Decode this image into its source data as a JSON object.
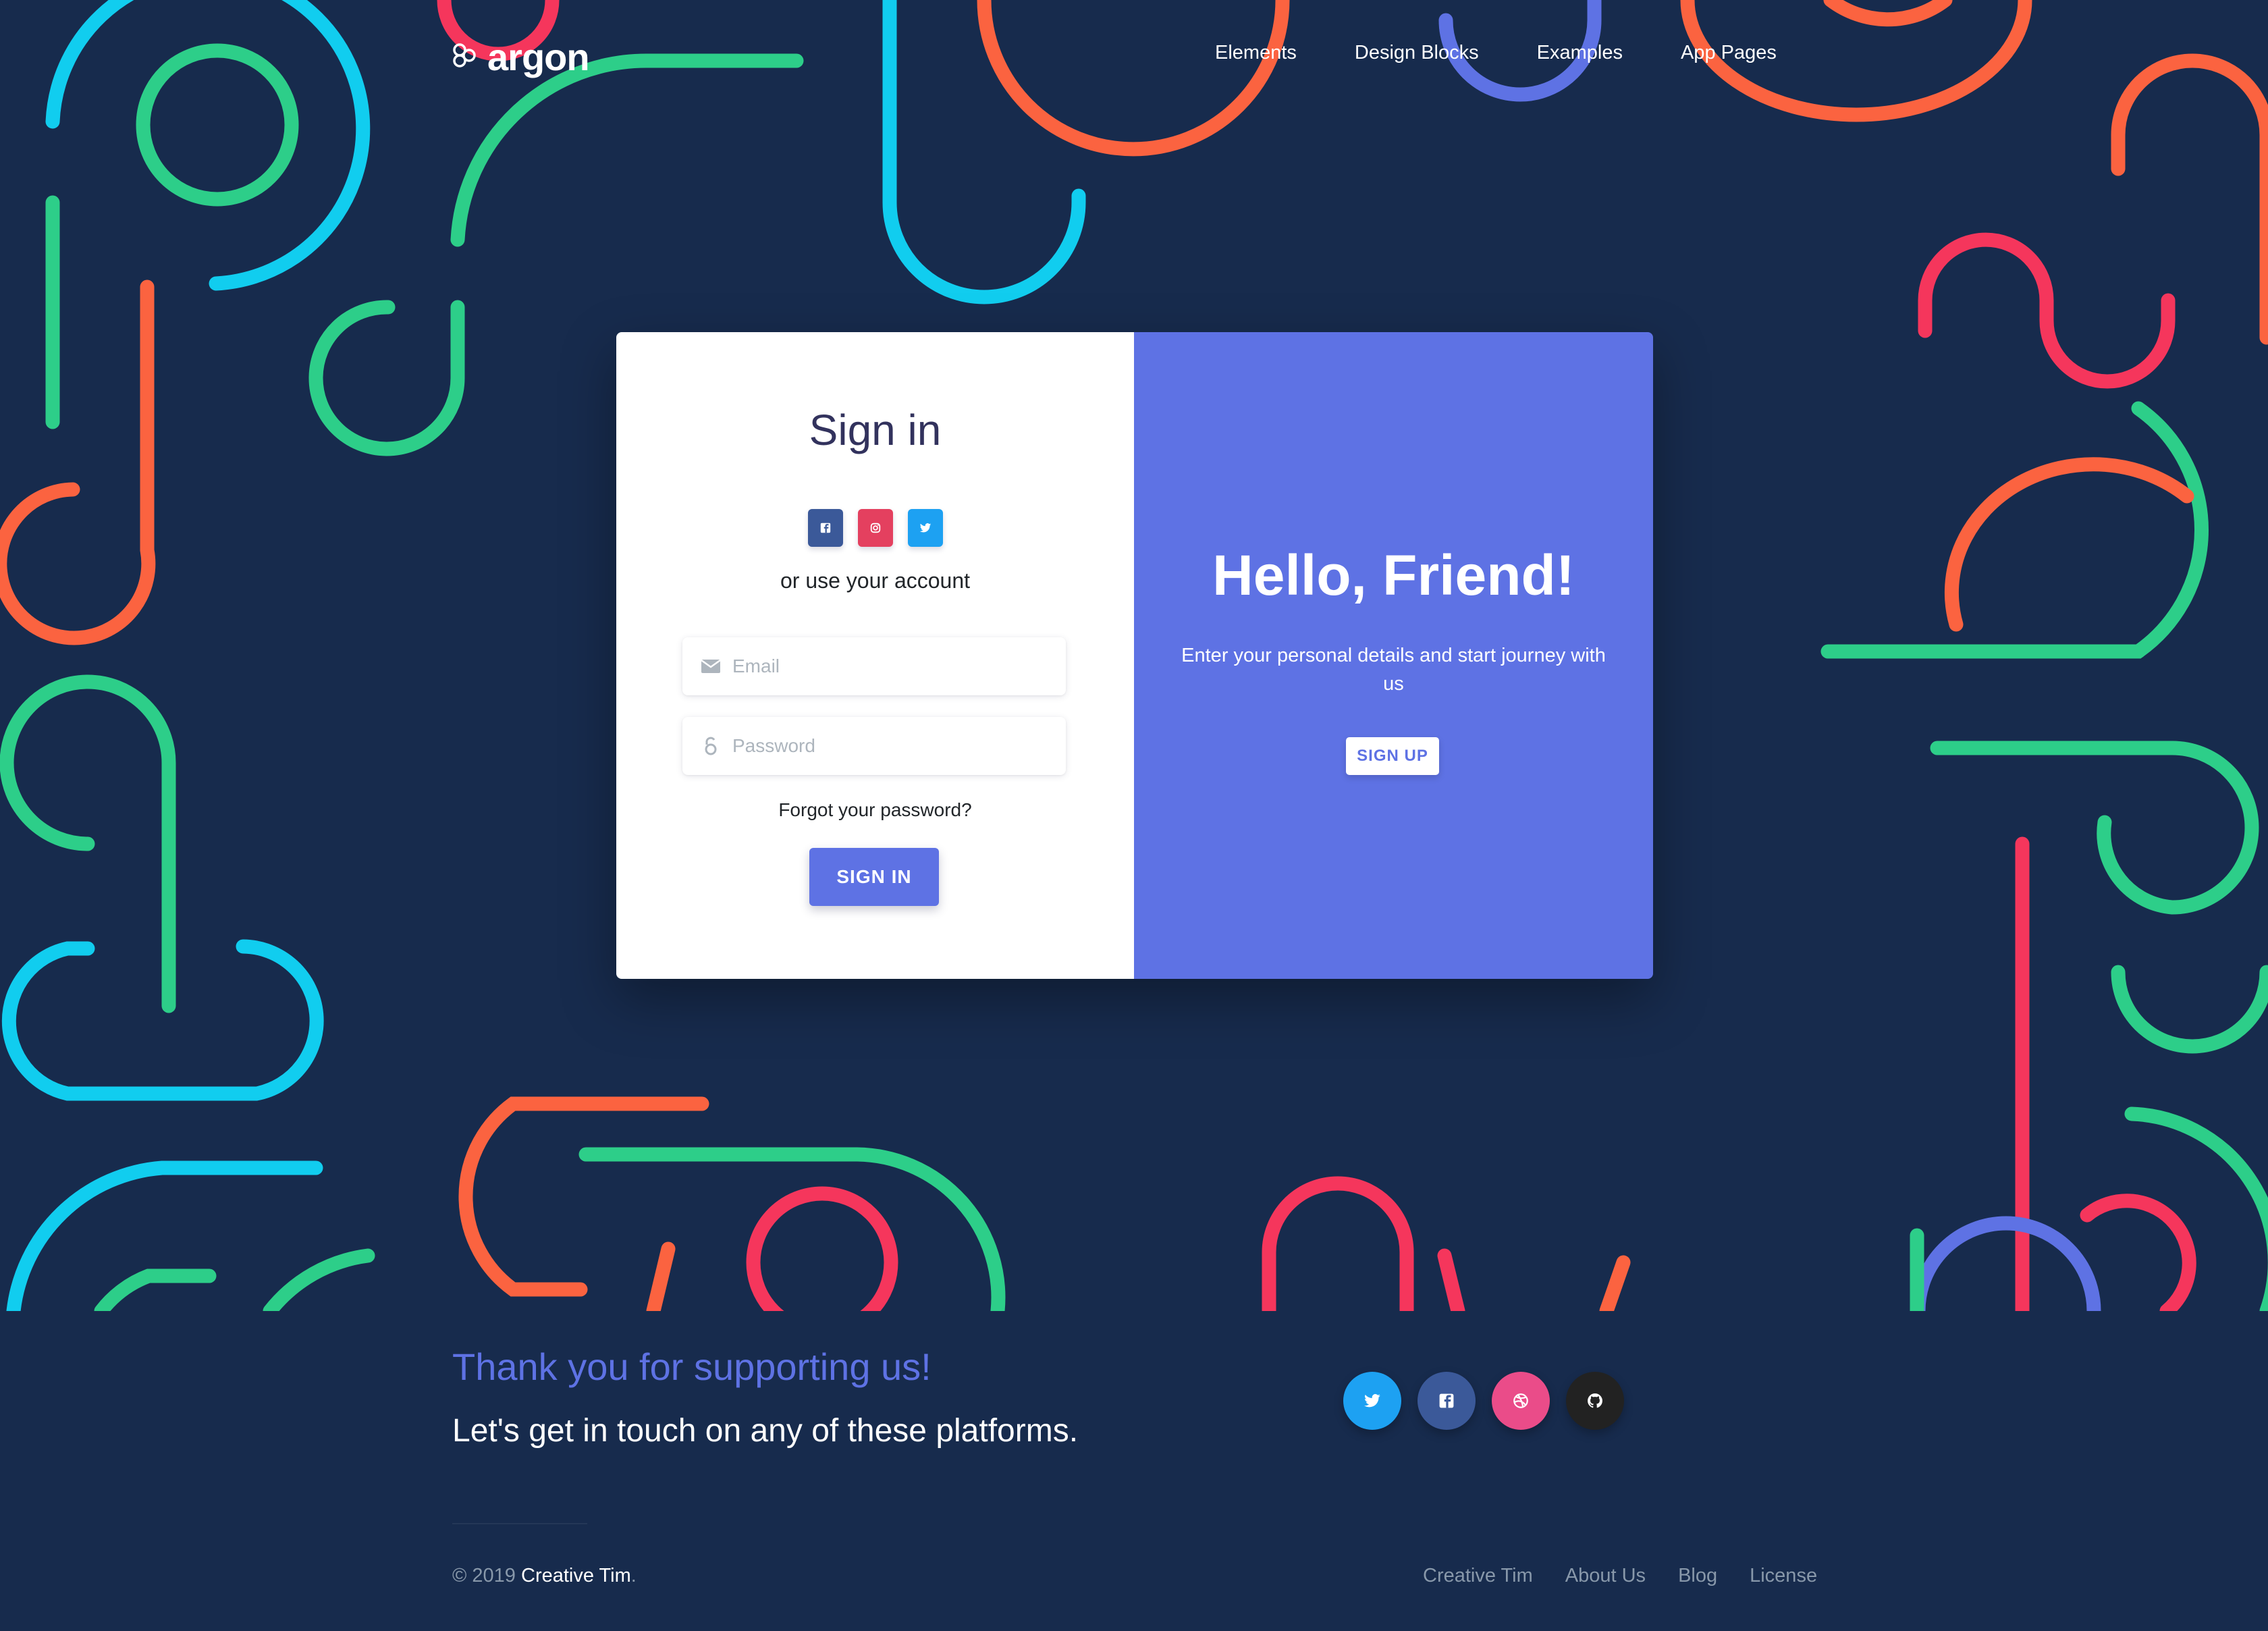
{
  "brand": {
    "name": "argon"
  },
  "nav": {
    "items": [
      "Elements",
      "Design Blocks",
      "Examples",
      "App Pages"
    ]
  },
  "signin": {
    "title": "Sign in",
    "social": [
      "facebook-icon",
      "instagram-icon",
      "twitter-icon"
    ],
    "use_account": "or use your account",
    "email_placeholder": "Email",
    "password_placeholder": "Password",
    "forgot": "Forgot your password?",
    "button": "SIGN IN"
  },
  "welcome": {
    "title": "Hello, Friend!",
    "text": "Enter your personal details and start journey with us",
    "button": "SIGN UP"
  },
  "footer": {
    "thanks": "Thank you for supporting us!",
    "touch": "Let's get in touch on any of these platforms.",
    "social": [
      "twitter-icon",
      "facebook-icon",
      "dribbble-icon",
      "github-icon"
    ],
    "copyright_prefix": "© 2019",
    "copyright_owner": "Creative Tim",
    "copyright_suffix": ".",
    "links": [
      "Creative Tim",
      "About Us",
      "Blog",
      "License"
    ]
  },
  "colors": {
    "background": "#172b4d",
    "primary": "#5e72e4",
    "facebook": "#3b5999",
    "instagram": "#e4405f",
    "twitter": "#1da1f2",
    "dribbble": "#ea4c89",
    "github": "#222222",
    "shapes": [
      "#11cdef",
      "#2dce89",
      "#fb6340",
      "#f5365c",
      "#5e72e4"
    ]
  }
}
